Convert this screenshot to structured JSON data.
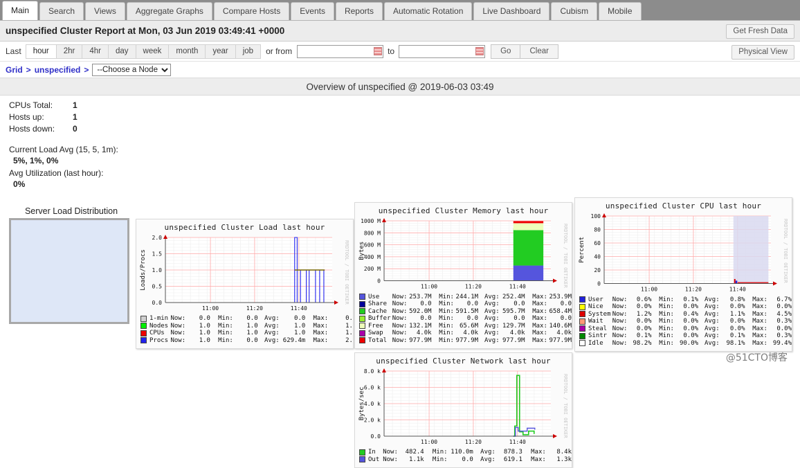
{
  "tabs": [
    {
      "label": "Main",
      "active": true
    },
    {
      "label": "Search",
      "active": false
    },
    {
      "label": "Views",
      "active": false
    },
    {
      "label": "Aggregate Graphs",
      "active": false
    },
    {
      "label": "Compare Hosts",
      "active": false
    },
    {
      "label": "Events",
      "active": false
    },
    {
      "label": "Reports",
      "active": false
    },
    {
      "label": "Automatic Rotation",
      "active": false
    },
    {
      "label": "Live Dashboard",
      "active": false
    },
    {
      "label": "Cubism",
      "active": false
    },
    {
      "label": "Mobile",
      "active": false
    }
  ],
  "report": {
    "title": "unspecified Cluster Report at Mon, 03 Jun 2019 03:49:41 +0000",
    "get_fresh_data_label": "Get Fresh Data",
    "physical_view_label": "Physical View"
  },
  "range": {
    "last_label": "Last",
    "options": [
      "hour",
      "2hr",
      "4hr",
      "day",
      "week",
      "month",
      "year",
      "job"
    ],
    "selected": "hour",
    "or_from_label": "or from",
    "from_value": "",
    "from_placeholder": "",
    "to_label": "to",
    "to_value": "",
    "to_placeholder": "",
    "go_label": "Go",
    "clear_label": "Clear"
  },
  "breadcrumb": {
    "grid_label": "Grid",
    "cluster_label": "unspecified",
    "separator": ">",
    "node_select_value": "--Choose a Node",
    "node_options": [
      "--Choose a Node"
    ]
  },
  "overview": {
    "heading": "Overview of unspecified @ 2019-06-03 03:49"
  },
  "summary": {
    "rows": [
      {
        "key": "CPUs Total:",
        "value": "1"
      },
      {
        "key": "Hosts up:",
        "value": "1"
      },
      {
        "key": "Hosts down:",
        "value": "0"
      }
    ],
    "current_load_label": "Current Load Avg (15, 5, 1m):",
    "current_load_value": "5%, 1%, 0%",
    "avg_util_label": "Avg Utilization (last hour):",
    "avg_util_value": "0%",
    "server_load_distribution_label": "Server Load Distribution"
  },
  "watermark": "@51CTO博客",
  "rrd_watermark": "RRDTOOL / TOBI OETIKER",
  "chart_data": [
    {
      "id": "load",
      "type": "line",
      "title": "unspecified Cluster Load last hour",
      "ylabel": "Loads/Procs",
      "xlabel": "",
      "ylim": [
        0.0,
        2.0
      ],
      "yticks": [
        "0.0",
        "0.5",
        "1.0",
        "1.5",
        "2.0"
      ],
      "xticks": [
        "11:00",
        "11:20",
        "11:40"
      ],
      "grid": true,
      "legend_position": "below",
      "legend_headers": [
        "Now:",
        "Min:",
        "Avg:",
        "Max:"
      ],
      "series": [
        {
          "name": "1-min",
          "color": "#d0d0d0",
          "now": "0.0",
          "min": "0.0",
          "avg": "0.0",
          "max": "0."
        },
        {
          "name": "Nodes",
          "color": "#00ee00",
          "now": "1.0",
          "min": "1.0",
          "avg": "1.0",
          "max": "1."
        },
        {
          "name": "CPUs",
          "color": "#ee0000",
          "now": "1.0",
          "min": "1.0",
          "avg": "1.0",
          "max": "1."
        },
        {
          "name": "Procs",
          "color": "#2222ee",
          "now": "1.0",
          "min": "0.0",
          "avg": "629.4m",
          "max": "2."
        }
      ]
    },
    {
      "id": "memory",
      "type": "area",
      "title": "unspecified Cluster Memory last hour",
      "ylabel": "Bytes",
      "xlabel": "",
      "ylim": [
        0,
        1000000000
      ],
      "yticks": [
        "0",
        "200 M",
        "400 M",
        "600 M",
        "800 M",
        "1000 M"
      ],
      "xticks": [
        "11:00",
        "11:20",
        "11:40"
      ],
      "grid": true,
      "legend_position": "below",
      "legend_headers": [
        "Now:",
        "Min:",
        "Avg:",
        "Max:"
      ],
      "series": [
        {
          "name": "Use",
          "color": "#5555dd",
          "now": "253.7M",
          "min": "244.1M",
          "avg": "252.4M",
          "max": "253.9M"
        },
        {
          "name": "Share",
          "color": "#000099",
          "now": "0.0",
          "min": "0.0",
          "avg": "0.0",
          "max": "0.0"
        },
        {
          "name": "Cache",
          "color": "#22cc22",
          "now": "592.0M",
          "min": "591.5M",
          "avg": "595.7M",
          "max": "658.4M"
        },
        {
          "name": "Buffer",
          "color": "#99ee33",
          "now": "0.0",
          "min": "0.0",
          "avg": "0.0",
          "max": "0.0"
        },
        {
          "name": "Free",
          "color": "#eeffbb",
          "now": "132.1M",
          "min": "65.6M",
          "avg": "129.7M",
          "max": "140.6M"
        },
        {
          "name": "Swap",
          "color": "#aa00aa",
          "now": "4.0k",
          "min": "4.0k",
          "avg": "4.0k",
          "max": "4.0k"
        },
        {
          "name": "Total",
          "color": "#ee0000",
          "now": "977.9M",
          "min": "977.9M",
          "avg": "977.9M",
          "max": "977.9M"
        }
      ]
    },
    {
      "id": "cpu",
      "type": "area",
      "title": "unspecified Cluster CPU last hour",
      "ylabel": "Percent",
      "xlabel": "",
      "ylim": [
        0,
        100
      ],
      "yticks": [
        "0",
        "20",
        "40",
        "60",
        "80",
        "100"
      ],
      "xticks": [
        "11:00",
        "11:20",
        "11:40"
      ],
      "grid": true,
      "legend_position": "below",
      "legend_headers": [
        "Now:",
        "Min:",
        "Avg:",
        "Max:"
      ],
      "series": [
        {
          "name": "User",
          "color": "#2222dd",
          "now": "0.6%",
          "min": "0.1%",
          "avg": "0.8%",
          "max": "6.7%"
        },
        {
          "name": "Nice",
          "color": "#ffff00",
          "now": "0.0%",
          "min": "0.0%",
          "avg": "0.0%",
          "max": "0.0%"
        },
        {
          "name": "System",
          "color": "#dd0000",
          "now": "1.2%",
          "min": "0.4%",
          "avg": "1.1%",
          "max": "4.5%"
        },
        {
          "name": "Wait",
          "color": "#ff9977",
          "now": "0.0%",
          "min": "0.0%",
          "avg": "0.0%",
          "max": "0.3%"
        },
        {
          "name": "Steal",
          "color": "#aa00aa",
          "now": "0.0%",
          "min": "0.0%",
          "avg": "0.0%",
          "max": "0.0%"
        },
        {
          "name": "Sintr",
          "color": "#008800",
          "now": "0.1%",
          "min": "0.0%",
          "avg": "0.1%",
          "max": "0.3%"
        },
        {
          "name": "Idle",
          "color": "#ffffff",
          "now": "98.2%",
          "min": "90.0%",
          "avg": "98.1%",
          "max": "99.4%"
        }
      ]
    },
    {
      "id": "network",
      "type": "line",
      "title": "unspecified Cluster Network last hour",
      "ylabel": "Bytes/sec",
      "xlabel": "",
      "ylim": [
        0,
        9000
      ],
      "yticks": [
        "0.0",
        "2.0 k",
        "4.0 k",
        "6.0 k",
        "8.0 k"
      ],
      "xticks": [
        "11:00",
        "11:20",
        "11:40"
      ],
      "grid": true,
      "legend_position": "below",
      "legend_headers": [
        "Now:",
        "Min:",
        "Avg:",
        "Max:"
      ],
      "series": [
        {
          "name": "In",
          "color": "#22cc22",
          "now": "482.4",
          "min": "110.0m",
          "avg": "878.3",
          "max": "8.4k"
        },
        {
          "name": "Out",
          "color": "#5555dd",
          "now": "1.1k",
          "min": "0.0",
          "avg": "619.1",
          "max": "1.3k"
        }
      ]
    }
  ]
}
